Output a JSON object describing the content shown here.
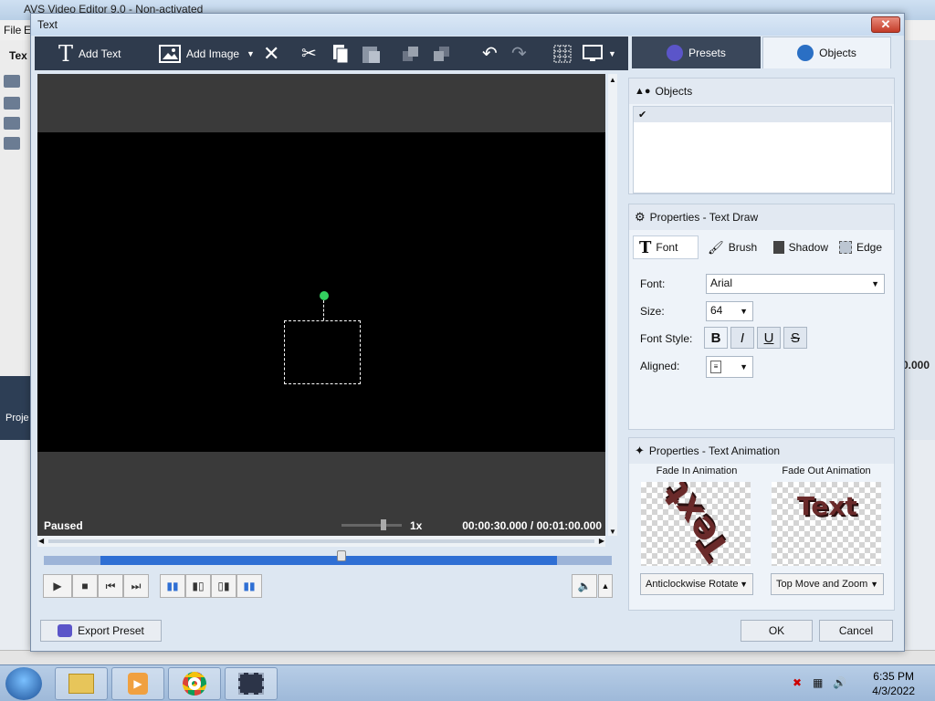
{
  "background_app": {
    "title": "AVS Video Editor 9.0 - Non-activated",
    "menu": [
      "File",
      "E"
    ],
    "panel_label": "Tex",
    "time_display": "0.000",
    "tools_label": "Proje"
  },
  "dialog": {
    "title": "Text",
    "toolbar": {
      "add_text": "Add Text",
      "add_image": "Add Image"
    },
    "tabs": {
      "presets": "Presets",
      "objects": "Objects"
    },
    "preview": {
      "status": "Paused",
      "speed": "1x",
      "time": "00:00:30.000  /  00:01:00.000"
    },
    "objects_panel": {
      "title": "Objects",
      "items": [
        {
          "checked": "✔"
        }
      ]
    },
    "properties": {
      "title": "Properties - Text Draw",
      "tabs": [
        "Font",
        "Brush",
        "Shadow",
        "Edge"
      ],
      "font_label": "Font:",
      "font_value": "Arial",
      "size_label": "Size:",
      "size_value": "64",
      "style_label": "Font Style:",
      "style_buttons": [
        "B",
        "I",
        "U",
        "S"
      ],
      "aligned_label": "Aligned:"
    },
    "animation": {
      "title": "Properties - Text Animation",
      "fade_in_label": "Fade In Animation",
      "fade_out_label": "Fade Out Animation",
      "fade_in_value": "Anticlockwise Rotate",
      "fade_out_value": "Top Move and Zoom",
      "preview_text": "Text"
    },
    "footer": {
      "export_preset": "Export Preset",
      "ok": "OK",
      "cancel": "Cancel"
    },
    "colors": {
      "toolbar_bg": "#2f3b4d",
      "video_bg": "#000000",
      "rotation_handle": "#34d160",
      "timeline_selection": "#2f6fd4"
    }
  },
  "taskbar": {
    "time": "6:35 PM",
    "date": "4/3/2022",
    "apps": [
      "explorer-icon",
      "media-player-icon",
      "chrome-icon",
      "avs-video-editor-icon"
    ]
  }
}
